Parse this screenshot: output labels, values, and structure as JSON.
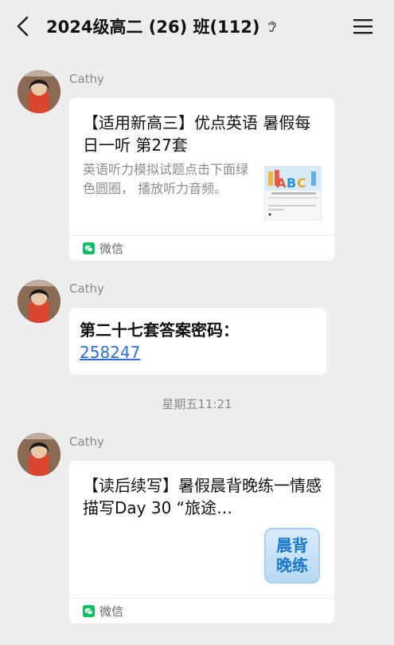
{
  "header": {
    "title": "2024级高二 (26) 班(112)",
    "back_icon": "chevron-left-icon",
    "ear_icon": "ear-icon",
    "menu_icon": "hamburger-menu-icon"
  },
  "messages": [
    {
      "sender": "Cathy",
      "card": {
        "title": "【适用新高三】优点英语 暑假每日一听 第27套",
        "description": "英语听力模拟试题点击下面绿色圆圈， 播放听力音频。",
        "source": "微信"
      }
    },
    {
      "sender": "Cathy",
      "text": "第二十七套答案密码：",
      "link": "258247"
    },
    {
      "sender": "Cathy",
      "card": {
        "title": "【读后续写】暑假晨背晚练一情感描写Day 30 “旅途…",
        "badge": [
          "晨背",
          "晚练"
        ],
        "source": "微信"
      }
    }
  ],
  "timestamp": "星期五11:21",
  "colors": {
    "background": "#ededed",
    "link": "#2b6fd6",
    "wechat_green": "#07c160"
  }
}
